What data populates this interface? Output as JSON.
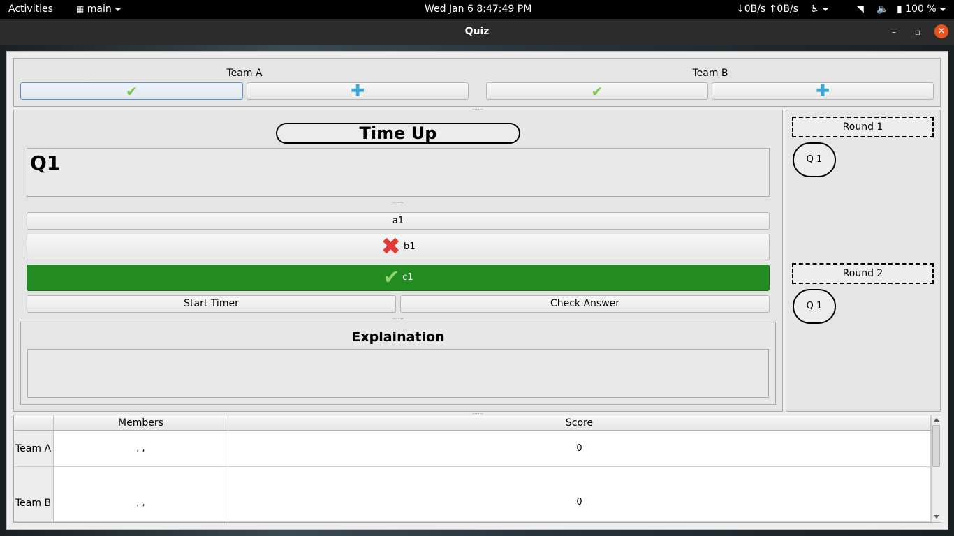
{
  "topbar": {
    "activities": "Activities",
    "app_menu": "main",
    "clock": "Wed Jan 6   8:47:49 PM",
    "net_speed": "↓0B/s ↑0B/s",
    "battery": "100 %"
  },
  "window": {
    "title": "Quiz",
    "minimize": "–",
    "maximize": "▫",
    "close": "×"
  },
  "teams": {
    "a_label": "Team A",
    "b_label": "Team B",
    "check_glyph": "✔",
    "plus_glyph": "✚"
  },
  "main": {
    "timer_text": "Time Up",
    "question": "Q1",
    "answers": [
      {
        "label": "a1",
        "state": "normal"
      },
      {
        "label": "b1",
        "state": "wrong",
        "mark": "✖"
      },
      {
        "label": "c1",
        "state": "correct",
        "mark": "✔"
      }
    ],
    "start_timer": "Start Timer",
    "check_answer": "Check Answer",
    "explanation_title": "Explaination",
    "explanation_text": ""
  },
  "rounds": [
    {
      "label": "Round 1",
      "questions": [
        "Q 1"
      ]
    },
    {
      "label": "Round 2",
      "questions": [
        "Q 1"
      ]
    }
  ],
  "scoreboard": {
    "headers": [
      "Members",
      "Score"
    ],
    "rows": [
      {
        "team": "Team A",
        "members": ", ,",
        "score": "0"
      },
      {
        "team": "Team B",
        "members": ", ,",
        "score": "0"
      }
    ]
  },
  "colors": {
    "correct_bg": "#228b22",
    "wrong_mark": "#e53935",
    "check_mark": "#7ac74f",
    "plus_mark": "#3aa6d8",
    "close_button": "#e95420"
  }
}
